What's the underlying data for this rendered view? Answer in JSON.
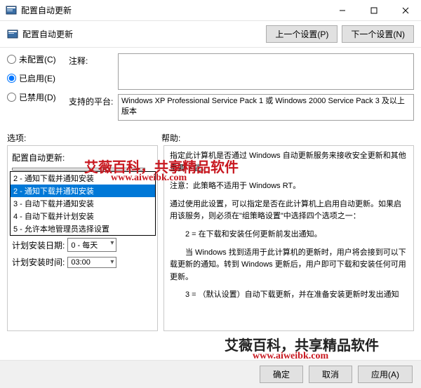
{
  "titlebar": {
    "title": "配置自动更新"
  },
  "subheader": {
    "label": "配置自动更新",
    "prev": "上一个设置(P)",
    "next": "下一个设置(N)"
  },
  "radios": {
    "notconfigured": "未配置(C)",
    "enabled": "已启用(E)",
    "disabled": "已禁用(D)"
  },
  "comment_label": "注释:",
  "platform_label": "支持的平台:",
  "platform_text": "Windows XP Professional Service Pack 1 或 Windows 2000 Service Pack 3 及以上版本",
  "options_label": "选项:",
  "help_label": "帮助:",
  "options": {
    "configure_label": "配置自动更新:",
    "schedule_day_label": "计划安装日期:",
    "schedule_day_value": "0 - 每天",
    "schedule_time_label": "计划安装时间:",
    "schedule_time_value": "03:00",
    "dropdown_items": [
      "2 - 通知下载并通知安装",
      "2 - 通知下载并通知安装",
      "3 - 自动下载并通知安装",
      "4 - 自动下载并计划安装",
      "5 - 允许本地管理员选择设置"
    ],
    "selected_index": 1
  },
  "help": {
    "p1": "指定此计算机是否通过 Windows 自动更新服务来接收安全更新和其他重要下载。",
    "p2": "注意：此策略不适用于 Windows RT。",
    "p3": "通过使用此设置，可以指定是否在此计算机上启用自动更新。如果启用该服务，则必须在\"组策略设置\"中选择四个选项之一：",
    "p4": "　　2 = 在下载和安装任何更新前发出通知。",
    "p5": "　　当 Windows 找到适用于此计算机的更新时，用户将会接到可以下载更新的通知。转到 Windows 更新后，用户即可下载和安装任何可用更新。",
    "p6": "　　3 = （默认设置）自动下载更新，并在准备安装更新时发出通知"
  },
  "watermark": {
    "line1": "艾薇百科，共享精品软件",
    "url": "www.aiweibk.com"
  },
  "footer": {
    "ok": "确定",
    "cancel": "取消",
    "apply": "应用(A)"
  }
}
